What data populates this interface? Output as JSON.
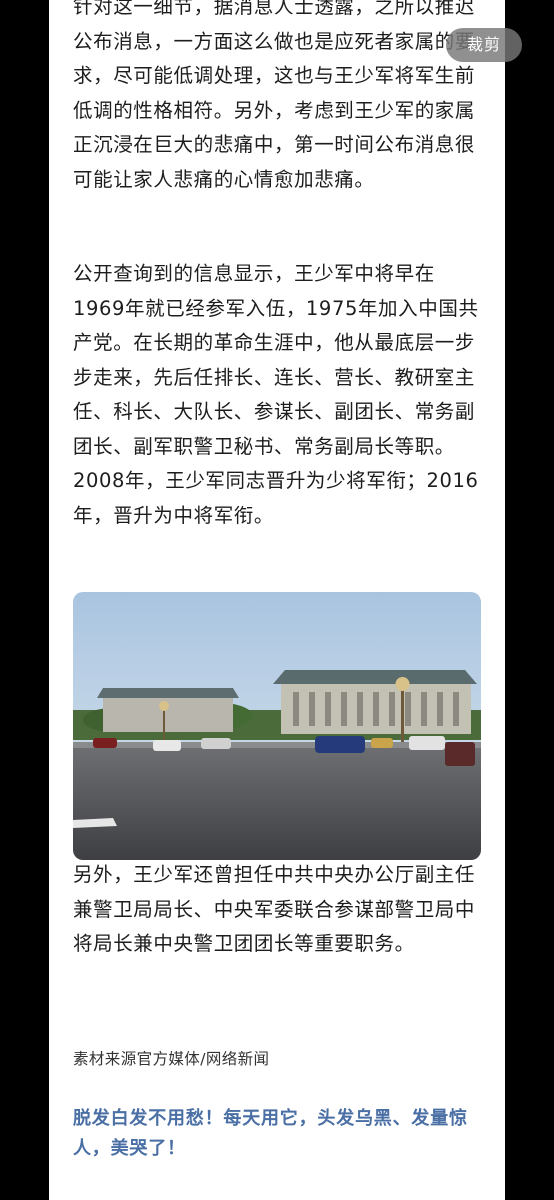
{
  "article": {
    "paragraph_1": "针对这一细节，据消息人士透露，之所以推迟公布消息，一方面这么做也是应死者家属的要求，尽可能低调处理，这也与王少军将军生前低调的性格相符。另外，考虑到王少军的家属正沉浸在巨大的悲痛中，第一时间公布消息很可能让家人悲痛的心情愈加悲痛。",
    "paragraph_2": "公开查询到的信息显示，王少军中将早在1969年就已经参军入伍，1975年加入中国共产党。在长期的革命生涯中，他从最底层一步步走来，先后任排长、连长、营长、教研室主任、科长、大队长、参谋长、副团长、常务副团长、副军职警卫秘书、常务副局长等职。2008年，王少军同志晋升为少将军衔；2016年，晋升为中将军衔。",
    "paragraph_3": "另外，王少军还曾担任中共中央办公厅副主任兼警卫局局长、中央军委联合参谋部警卫局中将局长兼中央警卫团团长等重要职务。",
    "source": "素材来源官方媒体/网络新闻",
    "promo": "脱发白发不用愁！每天用它，头发乌黑、发量惊人，美哭了！"
  },
  "overlay": {
    "clip_label": "裁剪"
  },
  "colors": {
    "page_bg": "#000000",
    "article_bg": "#ffffff",
    "text": "#1d1d1d",
    "promo": "#4a6fa5"
  }
}
